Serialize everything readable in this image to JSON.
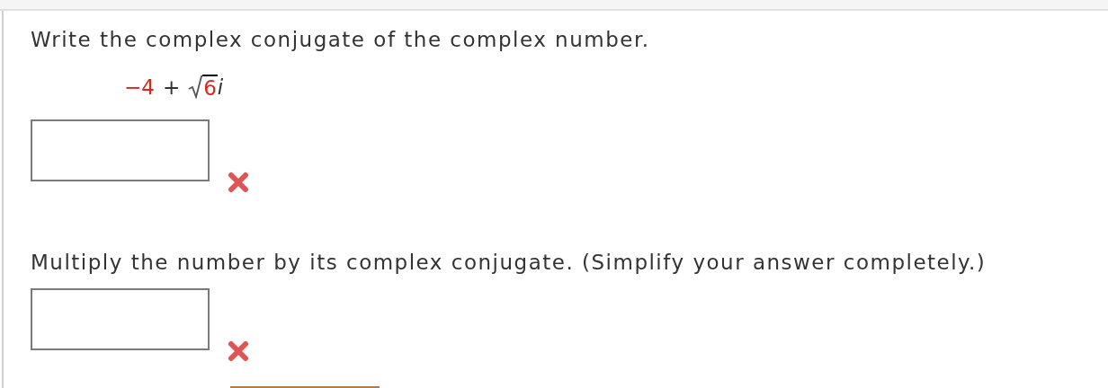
{
  "parts": [
    {
      "prompt": "Write the complex conjugate of the complex number.",
      "expression": {
        "real": "−4",
        "operator": "+",
        "radicand": "6",
        "unit": "i"
      },
      "answer": {
        "correct": false
      }
    },
    {
      "prompt": "Multiply the number by its complex conjugate. (Simplify your answer completely.)",
      "answer": {
        "correct": false
      }
    }
  ]
}
